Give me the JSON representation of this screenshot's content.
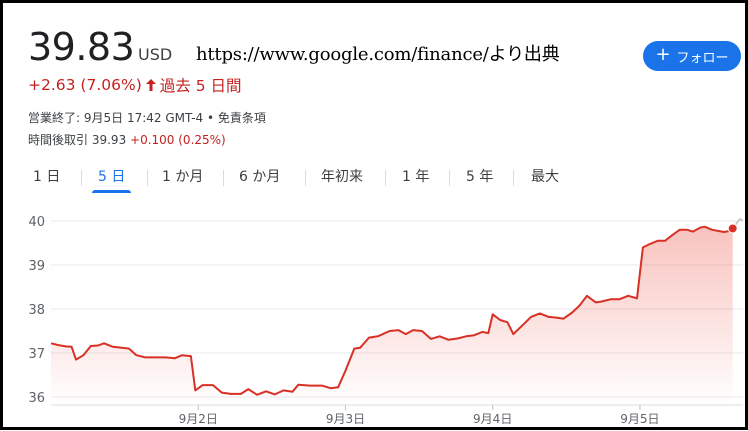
{
  "header": {
    "price": "39.83",
    "currency": "USD",
    "source": "https://www.google.com/finance/より出典",
    "change": "+2.63 (7.06%)",
    "change_period": "過去 5 日間",
    "change_color": "#c5221f"
  },
  "follow_button": {
    "label": "フォロー",
    "icon": "plus-icon",
    "color": "#1a73e8"
  },
  "meta": {
    "close_info": "営業終了: 9月5日 17:42 GMT-4 • 免責条項",
    "after_hours_label": "時間後取引",
    "after_hours_price": "39.93",
    "after_hours_change": "+0.100 (0.25%)"
  },
  "tabs": [
    {
      "label": "1 日",
      "active": false
    },
    {
      "label": "5 日",
      "active": true
    },
    {
      "label": "1 か月",
      "active": false
    },
    {
      "label": "6 か月",
      "active": false
    },
    {
      "label": "年初来",
      "active": false
    },
    {
      "label": "1 年",
      "active": false
    },
    {
      "label": "5 年",
      "active": false
    },
    {
      "label": "最大",
      "active": false
    }
  ],
  "chart_data": {
    "type": "area",
    "title": "",
    "xlabel": "",
    "ylabel": "",
    "ylim": [
      36,
      40
    ],
    "yticks": [
      36,
      37,
      38,
      39,
      40
    ],
    "x_range": [
      0,
      4.7
    ],
    "xtick_labels": [
      {
        "x": 1,
        "label": "9月2日"
      },
      {
        "x": 2,
        "label": "9月3日"
      },
      {
        "x": 3,
        "label": "9月4日"
      },
      {
        "x": 4,
        "label": "9月5日"
      }
    ],
    "grid": true,
    "line_color": "#d93025",
    "series": [
      {
        "values": [
          [
            0.0,
            37.22
          ],
          [
            0.05,
            37.18
          ],
          [
            0.1,
            37.15
          ],
          [
            0.14,
            37.14
          ],
          [
            0.17,
            36.85
          ],
          [
            0.22,
            36.95
          ],
          [
            0.27,
            37.16
          ],
          [
            0.32,
            37.17
          ],
          [
            0.36,
            37.22
          ],
          [
            0.42,
            37.14
          ],
          [
            0.48,
            37.12
          ],
          [
            0.53,
            37.1
          ],
          [
            0.58,
            36.95
          ],
          [
            0.64,
            36.9
          ],
          [
            0.7,
            36.9
          ],
          [
            0.78,
            36.9
          ],
          [
            0.84,
            36.88
          ],
          [
            0.89,
            36.95
          ],
          [
            0.95,
            36.93
          ],
          [
            0.98,
            36.15
          ],
          [
            1.03,
            36.27
          ],
          [
            1.1,
            36.27
          ],
          [
            1.16,
            36.1
          ],
          [
            1.22,
            36.07
          ],
          [
            1.29,
            36.07
          ],
          [
            1.34,
            36.18
          ],
          [
            1.4,
            36.05
          ],
          [
            1.46,
            36.13
          ],
          [
            1.52,
            36.06
          ],
          [
            1.58,
            36.15
          ],
          [
            1.64,
            36.12
          ],
          [
            1.68,
            36.28
          ],
          [
            1.76,
            36.26
          ],
          [
            1.84,
            36.26
          ],
          [
            1.9,
            36.2
          ],
          [
            1.95,
            36.22
          ],
          [
            2.0,
            36.6
          ],
          [
            2.06,
            37.1
          ],
          [
            2.1,
            37.12
          ],
          [
            2.16,
            37.35
          ],
          [
            2.22,
            37.38
          ],
          [
            2.3,
            37.5
          ],
          [
            2.36,
            37.52
          ],
          [
            2.41,
            37.43
          ],
          [
            2.46,
            37.52
          ],
          [
            2.52,
            37.5
          ],
          [
            2.58,
            37.32
          ],
          [
            2.64,
            37.38
          ],
          [
            2.7,
            37.3
          ],
          [
            2.76,
            37.33
          ],
          [
            2.82,
            37.38
          ],
          [
            2.87,
            37.4
          ],
          [
            2.93,
            37.48
          ],
          [
            2.97,
            37.45
          ],
          [
            3.0,
            37.88
          ],
          [
            3.05,
            37.75
          ],
          [
            3.1,
            37.7
          ],
          [
            3.14,
            37.43
          ],
          [
            3.2,
            37.62
          ],
          [
            3.26,
            37.82
          ],
          [
            3.32,
            37.9
          ],
          [
            3.38,
            37.82
          ],
          [
            3.44,
            37.8
          ],
          [
            3.48,
            37.78
          ],
          [
            3.54,
            37.92
          ],
          [
            3.59,
            38.08
          ],
          [
            3.64,
            38.3
          ],
          [
            3.7,
            38.15
          ],
          [
            3.74,
            38.17
          ],
          [
            3.8,
            38.22
          ],
          [
            3.86,
            38.22
          ],
          [
            3.92,
            38.3
          ],
          [
            3.98,
            38.24
          ],
          [
            4.02,
            39.4
          ],
          [
            4.07,
            39.48
          ],
          [
            4.12,
            39.55
          ],
          [
            4.17,
            39.55
          ],
          [
            4.22,
            39.68
          ],
          [
            4.27,
            39.8
          ],
          [
            4.32,
            39.8
          ],
          [
            4.36,
            39.76
          ],
          [
            4.41,
            39.85
          ],
          [
            4.44,
            39.87
          ],
          [
            4.49,
            39.8
          ],
          [
            4.54,
            39.77
          ],
          [
            4.57,
            39.75
          ],
          [
            4.62,
            39.78
          ],
          [
            4.63,
            39.83
          ]
        ]
      },
      {
        "name": "after-hours",
        "color": "#bdc1c6",
        "values": [
          [
            4.63,
            39.83
          ],
          [
            4.68,
            40.05
          ],
          [
            4.7,
            40.0
          ]
        ]
      }
    ],
    "last_point": [
      4.63,
      39.83
    ]
  }
}
